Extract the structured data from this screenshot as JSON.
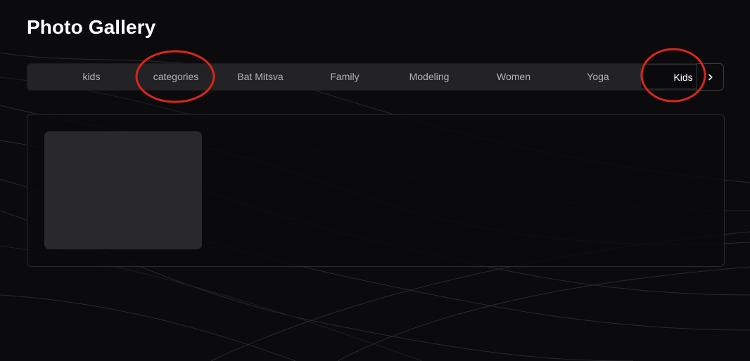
{
  "page": {
    "title": "Photo Gallery"
  },
  "tabs": [
    {
      "label": "kids",
      "active": false
    },
    {
      "label": "categories",
      "active": false
    },
    {
      "label": "Bat Mitsva",
      "active": false
    },
    {
      "label": "Family",
      "active": false
    },
    {
      "label": "Modeling",
      "active": false
    },
    {
      "label": "Women",
      "active": false
    },
    {
      "label": "Yoga",
      "active": false
    },
    {
      "label": "Kids",
      "active": true
    }
  ],
  "scroll_button": {
    "icon": "chevron-right-icon"
  },
  "gallery": {
    "items": [
      {
        "type": "photo-placeholder"
      }
    ]
  },
  "colors": {
    "background": "#0b0b0d",
    "tabbar": "#232326",
    "active_tab": "#0a0a0c",
    "annotation_circle": "#d9261c",
    "thumbnail": "#29292c"
  }
}
